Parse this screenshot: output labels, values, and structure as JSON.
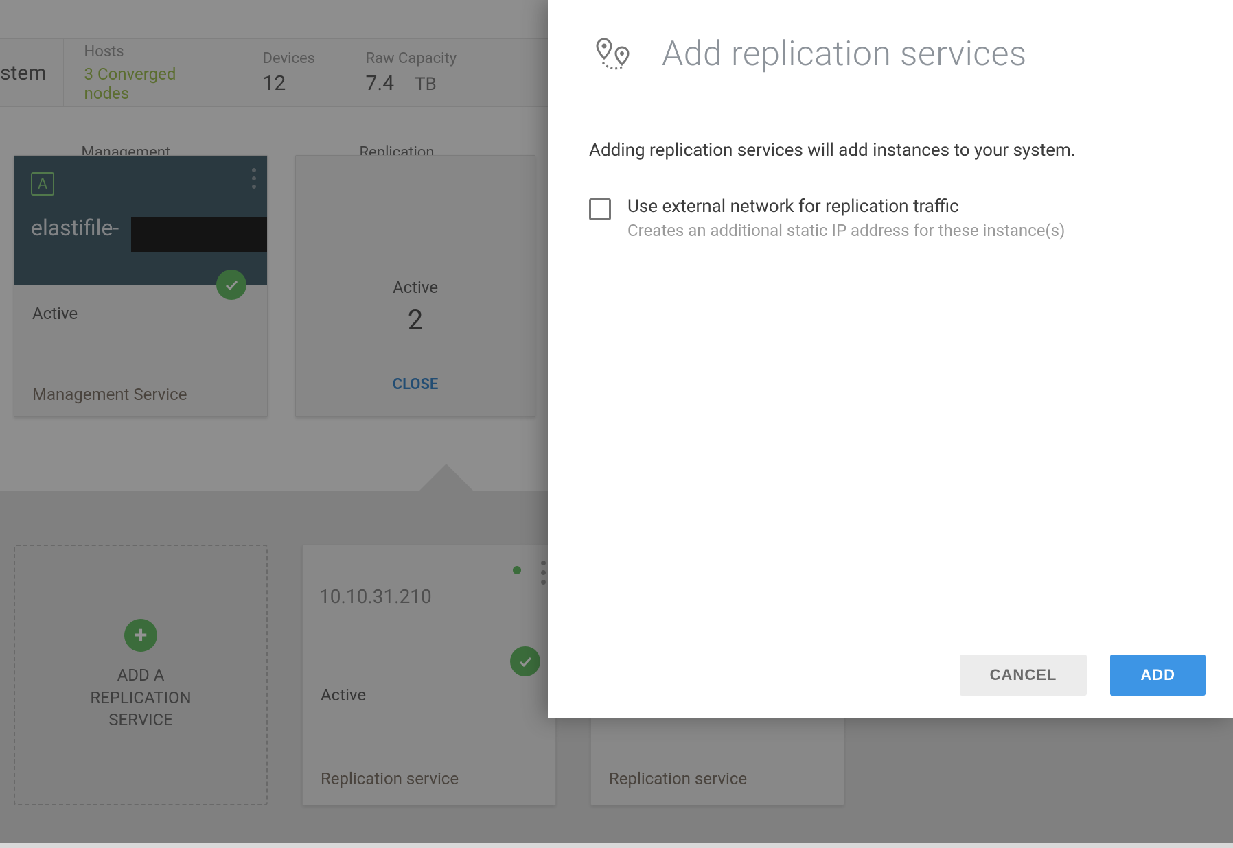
{
  "header": {
    "system_label_fragment": "stem",
    "hosts_label": "Hosts",
    "hosts_value": "3 Converged nodes",
    "devices_label": "Devices",
    "devices_value": "12",
    "raw_label": "Raw Capacity",
    "raw_value": "7.4",
    "raw_unit": "TB"
  },
  "management_panel": {
    "title": "Management services",
    "badge_letter": "A",
    "name": "elastifile-",
    "status": "Active",
    "service_label": "Management Service"
  },
  "replication_panel": {
    "title": "Replication services",
    "status_label": "Active",
    "count": "2",
    "close_label": "CLOSE"
  },
  "add_tile": {
    "line1": "ADD A",
    "line2": "REPLICATION",
    "line3": "SERVICE"
  },
  "repl_instances": [
    {
      "ip": "10.10.31.210",
      "status": "Active",
      "service_label": "Replication service"
    },
    {
      "ip": "",
      "status": "",
      "service_label": "Replication service"
    }
  ],
  "modal": {
    "title": "Add replication services",
    "description": "Adding replication services will add instances to your system.",
    "checkbox_label": "Use external network for replication traffic",
    "checkbox_sub": "Creates an additional static IP address for these instance(s)",
    "cancel": "CANCEL",
    "add": "ADD"
  }
}
